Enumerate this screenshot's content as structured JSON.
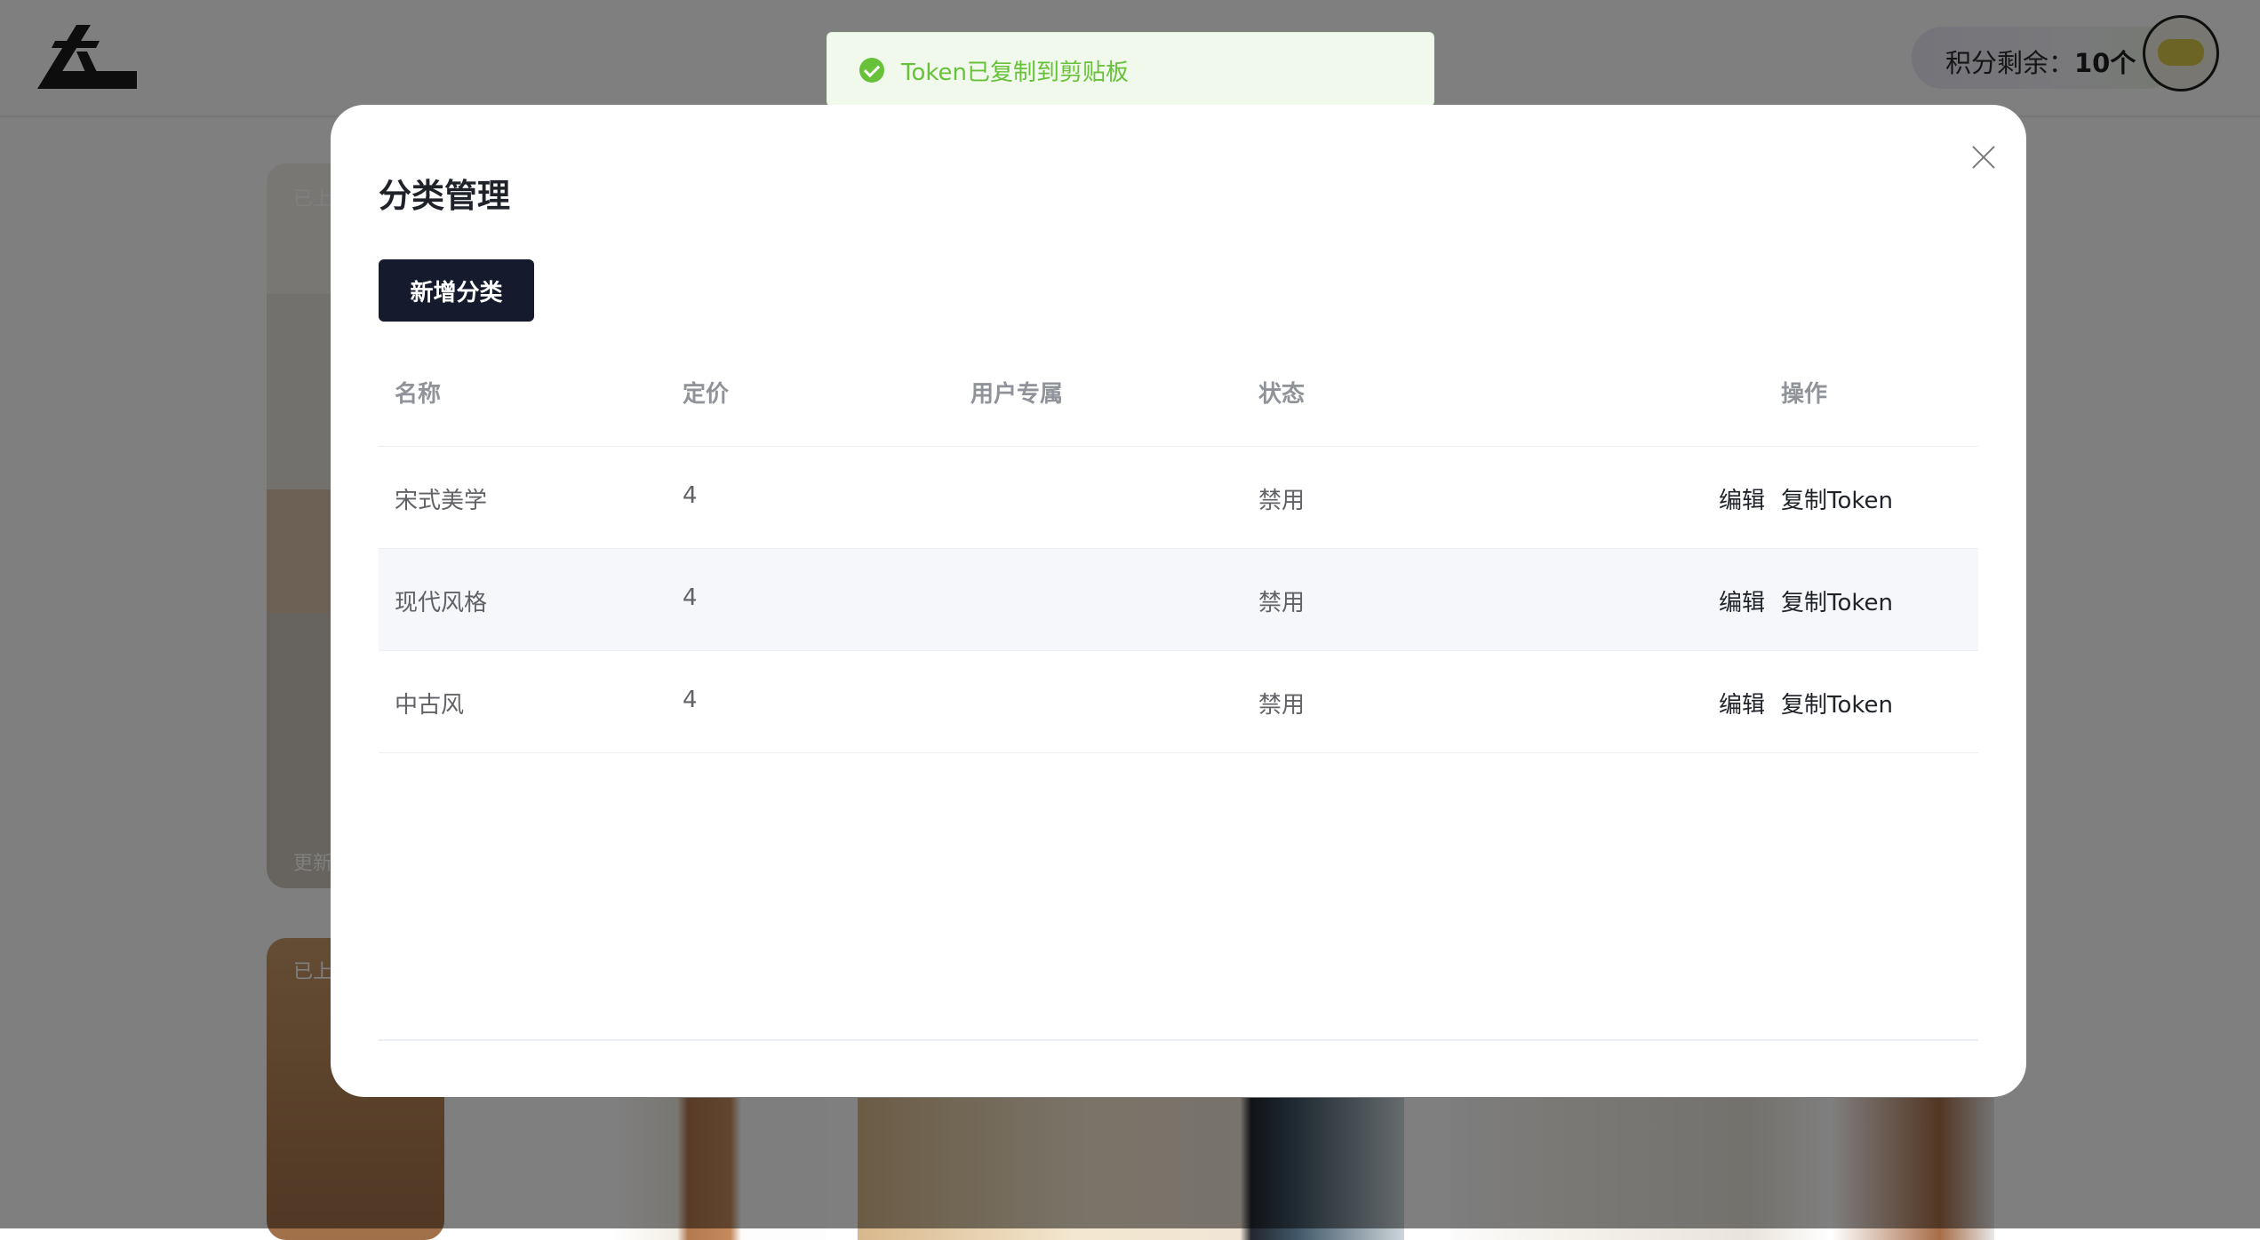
{
  "header": {
    "points_label": "积分剩余：",
    "points_value": "10个"
  },
  "background_cards": {
    "tag_listed": "已上",
    "tag_update": "更新"
  },
  "toast": {
    "message": "Token已复制到剪贴板",
    "icon": "check-circle-icon",
    "color": "#67c23a"
  },
  "modal": {
    "title": "分类管理",
    "add_button": "新增分类",
    "columns": [
      "名称",
      "定价",
      "用户专属",
      "状态",
      "操作"
    ],
    "rows": [
      {
        "name": "宋式美学",
        "price": "4",
        "exclusive": "",
        "status": "禁用",
        "edit": "编辑",
        "copy": "复制Token"
      },
      {
        "name": "现代风格",
        "price": "4",
        "exclusive": "",
        "status": "禁用",
        "edit": "编辑",
        "copy": "复制Token"
      },
      {
        "name": "中古风",
        "price": "4",
        "exclusive": "",
        "status": "禁用",
        "edit": "编辑",
        "copy": "复制Token"
      }
    ]
  }
}
